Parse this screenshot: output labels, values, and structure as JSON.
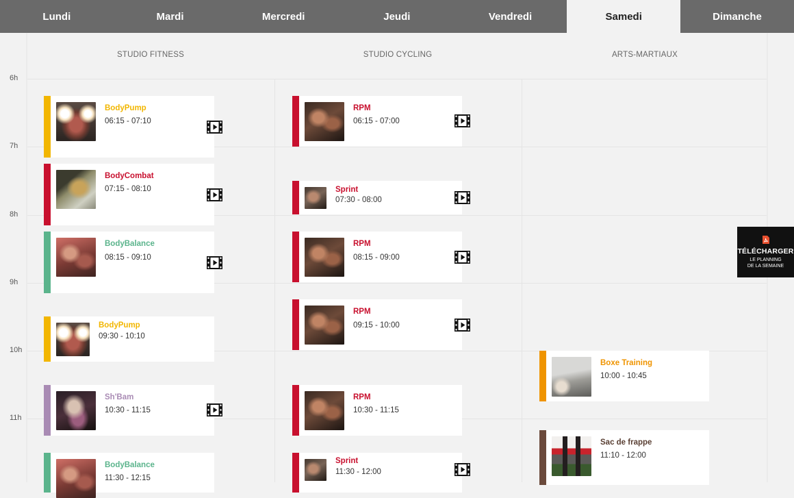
{
  "tabs": [
    "Lundi",
    "Mardi",
    "Mercredi",
    "Jeudi",
    "Vendredi",
    "Samedi",
    "Dimanche"
  ],
  "active_tab": "Samedi",
  "columns": [
    "STUDIO FITNESS",
    "STUDIO CYCLING",
    "ARTS-MARTIAUX"
  ],
  "hours": [
    "6h",
    "7h",
    "8h",
    "9h",
    "10h",
    "11h"
  ],
  "colors": {
    "yellow": "#f2b600",
    "red": "#c8102e",
    "green": "#5bb48c",
    "purple": "#a98bb4",
    "orange": "#ef9400",
    "brown": "#6b4a3c",
    "tabbar": "#6a6a6a"
  },
  "classes": {
    "fitness": [
      {
        "title": "BodyPump",
        "time": "06:15 - 07:10",
        "color": "#f2b600",
        "video": true,
        "photo": "bodypump"
      },
      {
        "title": "BodyCombat",
        "time": "07:15 - 08:10",
        "color": "#c8102e",
        "video": true,
        "photo": "bodycombat"
      },
      {
        "title": "BodyBalance",
        "time": "08:15 - 09:10",
        "color": "#5bb48c",
        "video": true,
        "photo": "bodybalance"
      },
      {
        "title": "BodyPump",
        "time": "09:30 - 10:10",
        "color": "#f2b600",
        "video": false,
        "photo": "bodypump"
      },
      {
        "title": "Sh'Bam",
        "time": "10:30 - 11:15",
        "color": "#a98bb4",
        "video": true,
        "photo": "shbam"
      },
      {
        "title": "BodyBalance",
        "time": "11:30 - 12:15",
        "color": "#5bb48c",
        "video": false,
        "photo": "bodybalance"
      }
    ],
    "cycling": [
      {
        "title": "RPM",
        "time": "06:15 - 07:00",
        "color": "#c8102e",
        "video": true,
        "photo": "rpm"
      },
      {
        "title": "Sprint",
        "time": "07:30 - 08:00",
        "color": "#c8102e",
        "video": true,
        "photo": "sprint"
      },
      {
        "title": "RPM",
        "time": "08:15 - 09:00",
        "color": "#c8102e",
        "video": true,
        "photo": "rpm"
      },
      {
        "title": "RPM",
        "time": "09:15 - 10:00",
        "color": "#c8102e",
        "video": true,
        "photo": "rpm"
      },
      {
        "title": "RPM",
        "time": "10:30 - 11:15",
        "color": "#c8102e",
        "video": false,
        "photo": "rpm"
      },
      {
        "title": "Sprint",
        "time": "11:30 - 12:00",
        "color": "#c8102e",
        "video": true,
        "photo": "sprint"
      }
    ],
    "martial": [
      {
        "title": "Boxe Training",
        "time": "10:00 - 10:45",
        "color": "#ef9400",
        "video": false,
        "photo": "boxe"
      },
      {
        "title": "Sac de frappe",
        "time": "11:10 - 12:00",
        "color": "#6b4a3c",
        "title_color": "#5a4034",
        "video": false,
        "photo": "sac"
      }
    ]
  },
  "download": {
    "label": "TÉLÉCHARGER",
    "sub1": "LE PLANNING",
    "sub2": "DE LA SEMAINE",
    "icon": "pdf-icon"
  }
}
